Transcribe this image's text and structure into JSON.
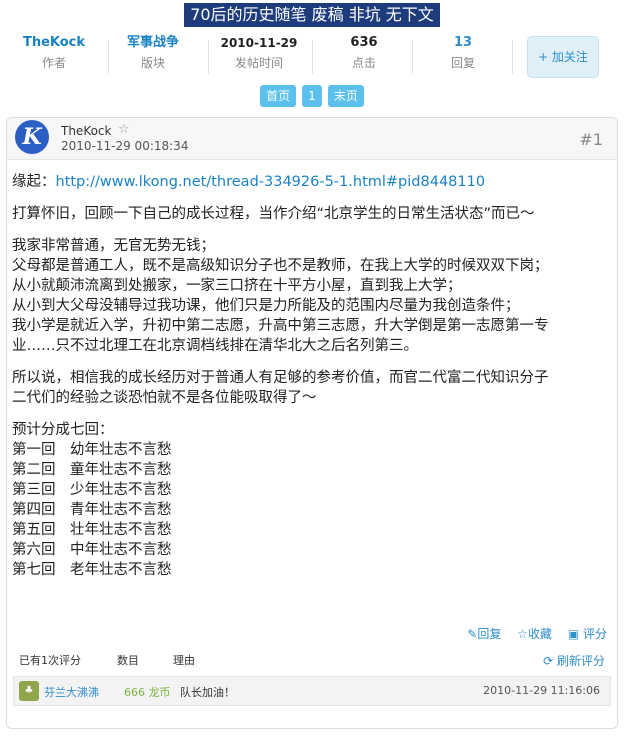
{
  "thread": {
    "title": "70后的历史随笔 废稿 非坑 无下文"
  },
  "stats": {
    "author": {
      "value": "TheKock",
      "label": "作者"
    },
    "board": {
      "value": "军事战争",
      "label": "版块"
    },
    "post_time": {
      "value": "2010-11-29",
      "label": "发帖时间"
    },
    "views": {
      "value": "636",
      "label": "点击"
    },
    "replies": {
      "value": "13",
      "label": "回复"
    },
    "follow_button": "+ 加关注"
  },
  "pager": {
    "first": "首页",
    "current": "1",
    "last": "末页"
  },
  "post": {
    "avatar_letter": "K",
    "author": "TheKock",
    "time": "2010-11-29 00:18:34",
    "floor": "#1",
    "content": {
      "origin_prefix": "缘起：",
      "origin_link": "http://www.lkong.net/thread-334926-5-1.html#pid8448110",
      "intro": "打算怀旧，回顾一下自己的成长过程，当作介绍“北京学生的日常生活状态”而已～",
      "family": [
        "我家非常普通，无官无势无钱；",
        "父母都是普通工人，既不是高级知识分子也不是教师，在我上大学的时候双双下岗；",
        "从小就颠沛流离到处搬家，一家三口挤在十平方小屋，直到我上大学；",
        "从小到大父母没辅导过我功课，他们只是力所能及的范围内尽量为我创造条件；",
        "我小学是就近入学，升初中第二志愿，升高中第三志愿，升大学倒是第一志愿第一专",
        "业……只不过北理工在北京调档线排在清华北大之后名列第三。"
      ],
      "reference": [
        "所以说，相信我的成长经历对于普通人有足够的参考价值，而官二代富二代知识分子",
        "二代们的经验之谈恐怕就不是各位能吸取得了～"
      ],
      "chapters_intro": "预计分成七回：",
      "chapters": [
        "第一回　幼年壮志不言愁",
        "第二回　童年壮志不言愁",
        "第三回　少年壮志不言愁",
        "第四回　青年壮志不言愁",
        "第五回　壮年壮志不言愁",
        "第六回　中年壮志不言愁",
        "第七回　老年壮志不言愁"
      ]
    },
    "actions": {
      "reply": "回复",
      "favorite": "收藏",
      "rate": "评分"
    }
  },
  "rating": {
    "count_label": "已有1次评分",
    "col_amount": "数目",
    "col_reason": "理由",
    "refresh": "刷新评分",
    "rows": [
      {
        "user": "芬兰大沸沸",
        "value": "666 龙币",
        "reason": "队长加油！",
        "time": "2010-11-29 11:16:06"
      }
    ]
  },
  "colors": {
    "title_bg": "#1e3c7b",
    "accent": "#2e8ec9",
    "pager_bg": "#5bc0eb",
    "avatar_bg": "#2b5fc3"
  }
}
